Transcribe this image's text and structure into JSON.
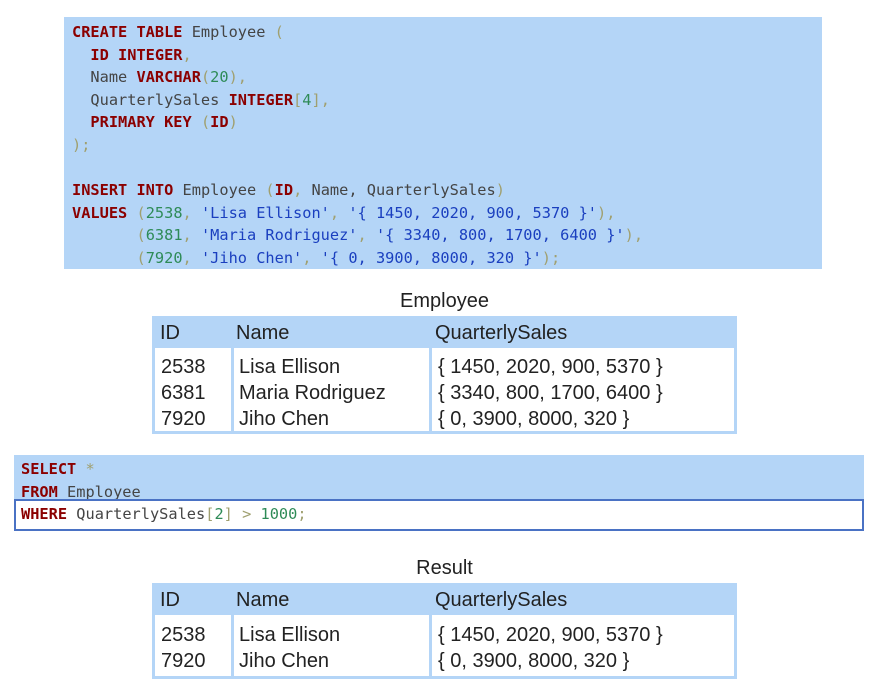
{
  "create_sql": {
    "line1": {
      "kw": "CREATE TABLE",
      "name": " Employee ",
      "paren": "("
    },
    "line2": {
      "kw": "ID INTEGER",
      "comma": ","
    },
    "line3": {
      "name": "Name ",
      "kw": "VARCHAR",
      "p1": "(",
      "num": "20",
      "p2": "),"
    },
    "line4": {
      "name": "QuarterlySales ",
      "kw": "INTEGER",
      "p1": "[",
      "num": "4",
      "p2": "],"
    },
    "line5": {
      "kw": "PRIMARY KEY",
      "p1": " (",
      "kw2": "ID",
      "p2": ")"
    },
    "line6": {
      "p": ");"
    },
    "line8": {
      "kw": "INSERT INTO",
      "name": " Employee ",
      "p1": "(",
      "kw2": "ID",
      "p2": ",",
      "rest": " Name, QuarterlySales",
      "p3": ")"
    },
    "line9": {
      "kw": "VALUES",
      "p1": " (",
      "num": "2538",
      "p2": ",",
      "s1": " 'Lisa Ellison'",
      "p3": ",",
      "s2": " '{ 1450, 2020, 900, 5370 }'",
      "p4": "),"
    },
    "line10": {
      "p1": "(",
      "num": "6381",
      "p2": ",",
      "s1": " 'Maria Rodriguez'",
      "p3": ",",
      "s2": " '{ 3340, 800, 1700, 6400 }'",
      "p4": "),"
    },
    "line11": {
      "p1": "(",
      "num": "7920",
      "p2": ",",
      "s1": " 'Jiho Chen'",
      "p3": ",",
      "s2": " '{ 0, 3900, 8000, 320 }'",
      "p4": ");"
    }
  },
  "employee_table": {
    "title": "Employee",
    "headers": [
      "ID",
      "Name",
      "QuarterlySales"
    ],
    "rows": [
      [
        "2538",
        "Lisa Ellison",
        "{ 1450, 2020, 900, 5370 }"
      ],
      [
        "6381",
        "Maria Rodriguez",
        "{ 3340, 800, 1700, 6400 }"
      ],
      [
        "7920",
        "Jiho Chen",
        "{ 0, 3900, 8000, 320 }"
      ]
    ]
  },
  "select_sql": {
    "line1": {
      "kw": "SELECT",
      "p": " *"
    },
    "line2": {
      "kw": "FROM",
      "name": " Employee"
    },
    "line3": {
      "kw": "WHERE",
      "name": " QuarterlySales",
      "p1": "[",
      "num": "2",
      "p2": "]",
      "op": " > ",
      "num2": "1000",
      "p3": ";"
    }
  },
  "result_table": {
    "title": "Result",
    "headers": [
      "ID",
      "Name",
      "QuarterlySales"
    ],
    "rows": [
      [
        "2538",
        "Lisa Ellison",
        "{ 1450, 2020, 900, 5370 }"
      ],
      [
        "7920",
        "Jiho Chen",
        "{ 0, 3900, 8000, 320 }"
      ]
    ]
  }
}
